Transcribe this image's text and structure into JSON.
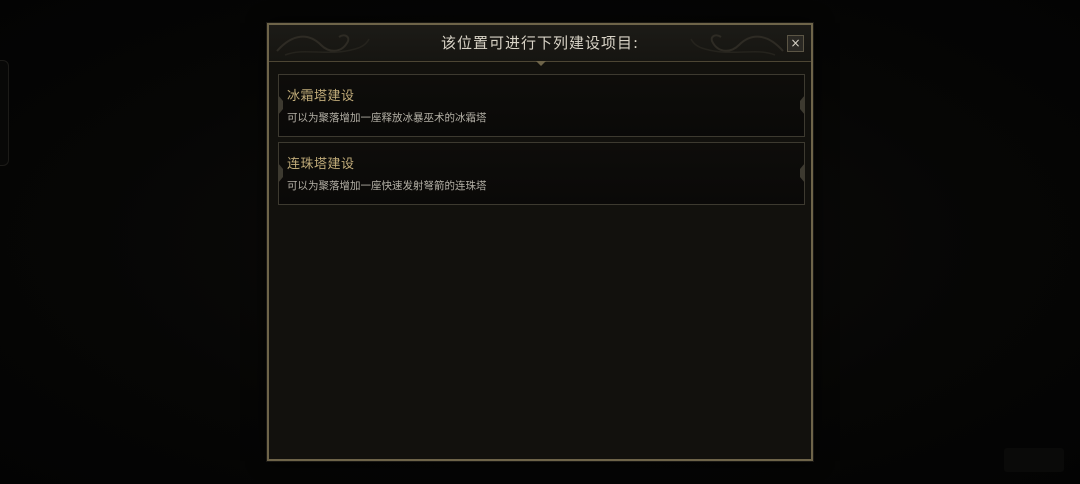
{
  "dialog": {
    "title": "该位置可进行下列建设项目:",
    "close_label": "×"
  },
  "options": [
    {
      "title": "冰霜塔建设",
      "description": "可以为聚落增加一座释放冰暴巫术的冰霜塔"
    },
    {
      "title": "连珠塔建设",
      "description": "可以为聚落增加一座快速发射弩箭的连珠塔"
    }
  ],
  "colors": {
    "frame": "#6e6449",
    "title_text": "#d8d3c6",
    "option_title": "#c0ab79",
    "option_desc": "#b4b0a6",
    "panel_bg": "#12110d"
  }
}
